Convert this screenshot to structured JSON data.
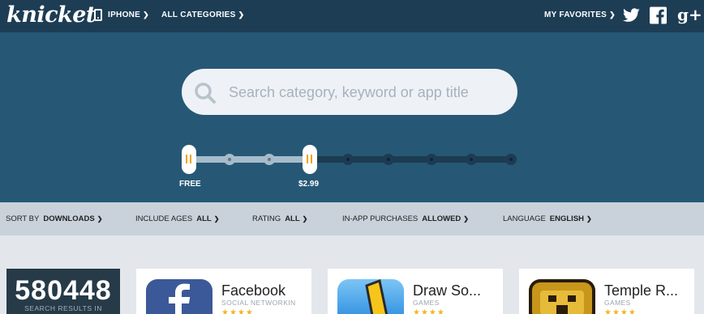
{
  "header": {
    "logo": "knicket",
    "device_label": "IPHONE",
    "categories_label": "ALL CATEGORIES",
    "favorites_label": "MY FAVORITES",
    "social": [
      "twitter-icon",
      "facebook-icon",
      "google-plus-icon"
    ]
  },
  "search": {
    "placeholder": "Search category, keyword or app title"
  },
  "price_slider": {
    "min_label": "FREE",
    "max_label": "$2.99",
    "steps": 9,
    "selected_range": [
      0,
      3
    ],
    "colors": {
      "handle_mark": "#f0a31a",
      "active_track": "#a6bccb",
      "inactive_track": "#1c3c52"
    }
  },
  "filters": [
    {
      "label": "SORT BY",
      "value": "DOWNLOADS"
    },
    {
      "label": "INCLUDE AGES",
      "value": "ALL"
    },
    {
      "label": "RATING",
      "value": "ALL"
    },
    {
      "label": "IN-APP PURCHASES",
      "value": "ALLOWED"
    },
    {
      "label": "LANGUAGE",
      "value": "ENGLISH"
    }
  ],
  "results": {
    "count": "580448",
    "count_label": "SEARCH RESULTS IN",
    "apps": [
      {
        "name": "Facebook",
        "category": "SOCIAL NETWORKIN",
        "icon": "facebook-app-icon",
        "color": "#3b5998"
      },
      {
        "name": "Draw So...",
        "category": "GAMES",
        "icon": "draw-something-app-icon",
        "color": "#2f8fe0"
      },
      {
        "name": "Temple R...",
        "category": "GAMES",
        "icon": "temple-run-app-icon",
        "color": "#c7961a"
      }
    ]
  },
  "colors": {
    "topbar": "#1d3d55",
    "hero": "#265875",
    "filterbar": "#c9d2da",
    "star": "#f3b61f"
  }
}
